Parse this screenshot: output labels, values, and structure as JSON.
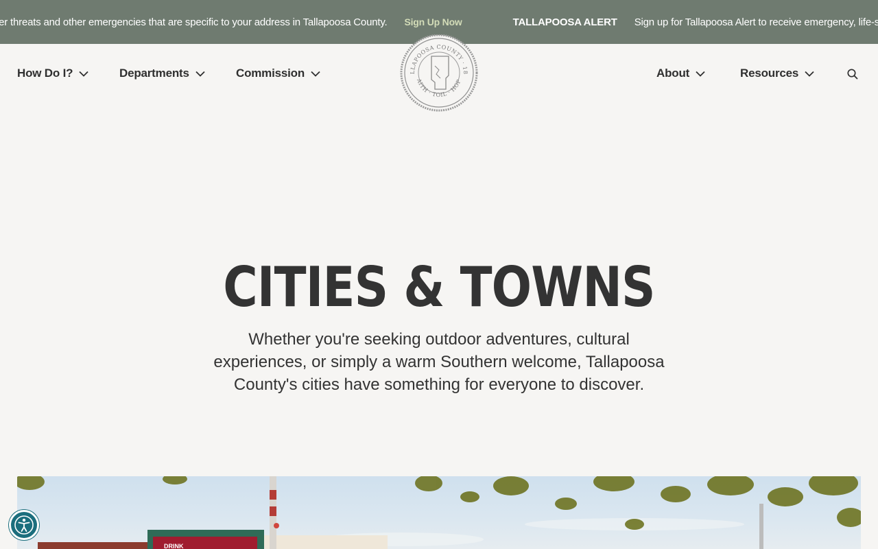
{
  "alert": {
    "text_before": "ner threats and other emergencies that are specific to your address in Tallapoosa County.",
    "link": "Sign Up Now",
    "title": "TALLAPOOSA ALERT",
    "text_after": "Sign up for Tallapoosa Alert to receive emergency, life-sa"
  },
  "nav": {
    "left": [
      "How Do I?",
      "Departments",
      "Commission"
    ],
    "right": [
      "About",
      "Resources"
    ],
    "search_icon": "search-icon"
  },
  "seal": {
    "text": "TALLAPOOSA COUNTY · 1832 · FAITH · TOIL · HOPE"
  },
  "hero": {
    "title": "CITIES & TOWNS",
    "subtitle": "Whether you're seeking outdoor adventures, cultural experiences, or simply a warm Southern welcome, Tallapoosa County's cities have something for everyone to discover."
  },
  "photo": {
    "sign_text": "DRINK"
  },
  "colors": {
    "alert_bg": "#6f7b70",
    "alert_link": "#d3dcb8",
    "page_bg": "#f6f5f3",
    "text": "#333333",
    "accessibility_button": "#1b6e7d"
  },
  "accessibility": {
    "icon": "accessibility-icon"
  }
}
